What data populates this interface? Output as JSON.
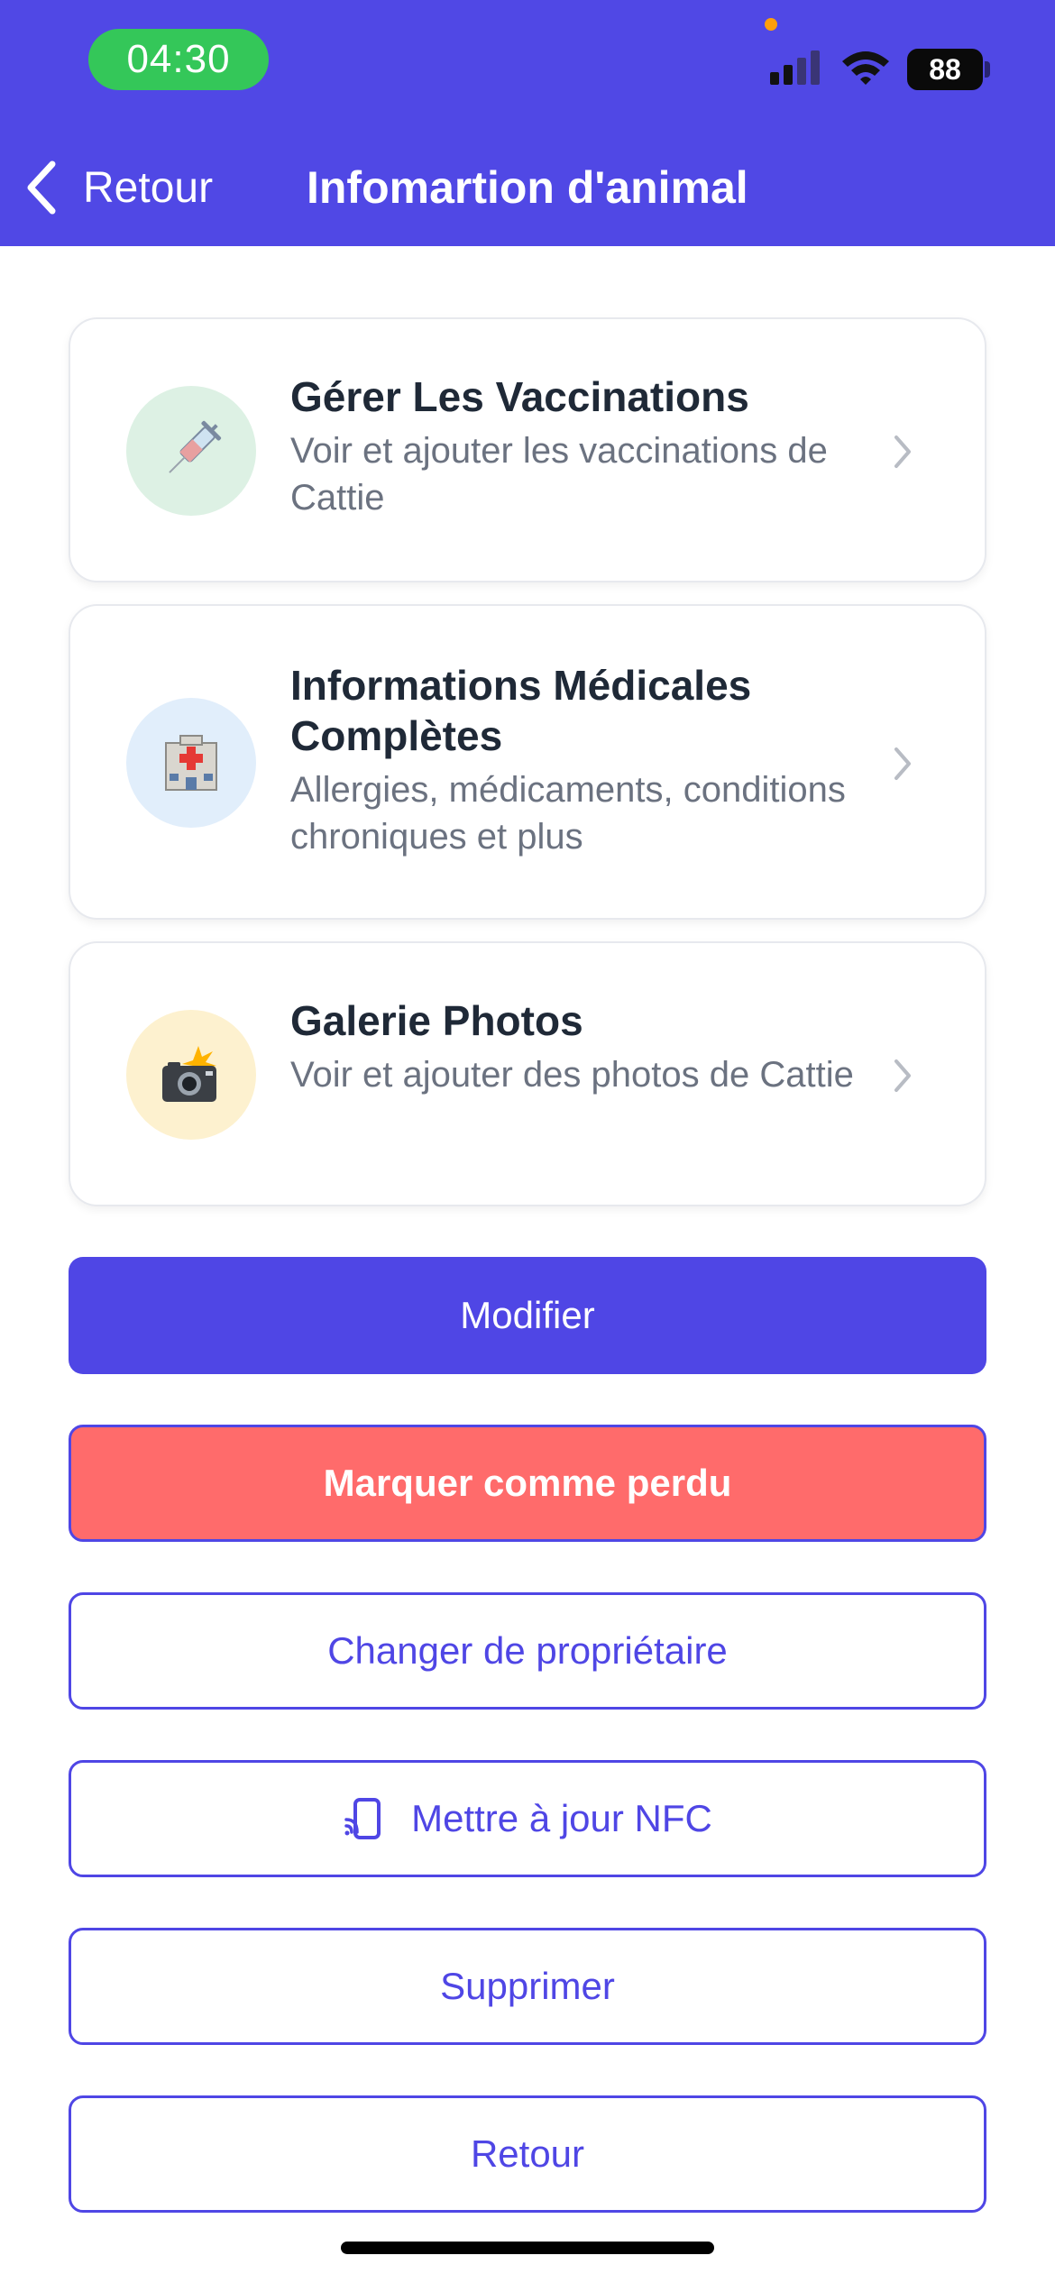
{
  "status_bar": {
    "time": "04:30",
    "battery": "88",
    "icons": [
      "signal-icon",
      "wifi-icon",
      "battery-icon"
    ]
  },
  "nav": {
    "back_label": "Retour",
    "title": "Infomartion d'animal"
  },
  "cards": [
    {
      "icon": "syringe-icon",
      "title": "Gérer Les Vaccinations",
      "description": "Voir et ajouter les vaccinations de Cattie"
    },
    {
      "icon": "hospital-icon",
      "title": "Informations Médicales Complètes",
      "description": "Allergies, médicaments, conditions chroniques et plus"
    },
    {
      "icon": "camera-flash-icon",
      "title": "Galerie Photos",
      "description": "Voir et ajouter des photos de Cattie"
    }
  ],
  "buttons": {
    "edit": "Modifier",
    "mark_lost": "Marquer comme perdu",
    "change_owner": "Changer de propriétaire",
    "update_nfc": "Mettre à jour NFC",
    "delete": "Supprimer",
    "back": "Retour"
  },
  "colors": {
    "primary": "#4F46E5",
    "header": "#5048E5",
    "danger": "#FF6B6B",
    "time_pill": "#34C759"
  }
}
